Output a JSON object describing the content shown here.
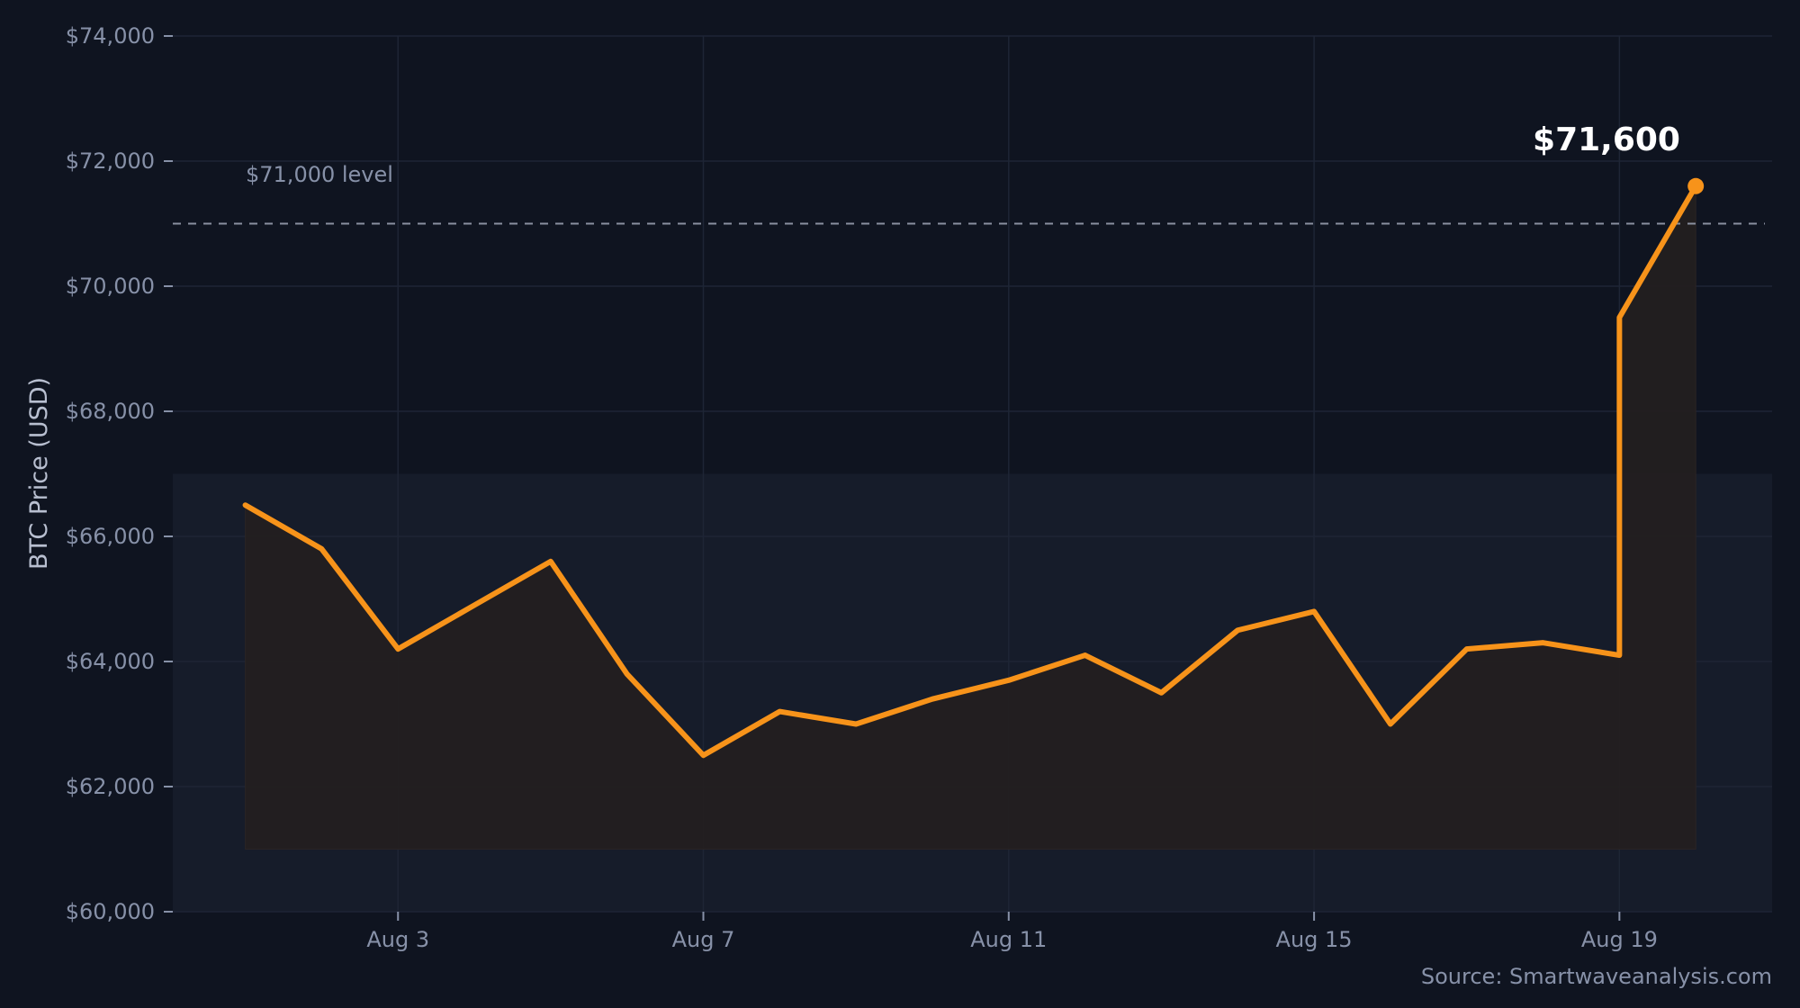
{
  "chart_data": {
    "type": "area",
    "x": [
      "Aug 1",
      "Aug 2",
      "Aug 3",
      "Aug 4",
      "Aug 5",
      "Aug 6",
      "Aug 7",
      "Aug 8",
      "Aug 9",
      "Aug 10",
      "Aug 11",
      "Aug 12",
      "Aug 13",
      "Aug 14",
      "Aug 15",
      "Aug 16",
      "Aug 17",
      "Aug 18",
      "Aug 19",
      "Aug 19",
      "Aug 20"
    ],
    "x_index": [
      1,
      2,
      3,
      4,
      5,
      6,
      7,
      8,
      9,
      10,
      11,
      12,
      13,
      14,
      15,
      16,
      17,
      18,
      19,
      19,
      20
    ],
    "series": [
      {
        "values": [
          66500,
          65800,
          64200,
          64900,
          65600,
          63800,
          62500,
          63200,
          63000,
          63400,
          63700,
          64100,
          63500,
          64500,
          64800,
          63000,
          64200,
          64300,
          64100,
          69500,
          71600
        ]
      }
    ],
    "xticks": [
      "Aug 3",
      "Aug 7",
      "Aug 11",
      "Aug 15",
      "Aug 19"
    ],
    "xtick_index": [
      3,
      7,
      11,
      15,
      19
    ],
    "yticks": [
      "$60,000",
      "$62,000",
      "$64,000",
      "$66,000",
      "$68,000",
      "$70,000",
      "$72,000",
      "$74,000"
    ],
    "ytick_values": [
      60000,
      62000,
      64000,
      66000,
      68000,
      70000,
      72000,
      74000
    ],
    "ylim": [
      60000,
      74000
    ],
    "ylabel": "BTC Price (USD)",
    "xlabel": "",
    "grid": true,
    "reference_line": {
      "value": 71000,
      "label": "$71,000 level"
    },
    "shaded_band": [
      61000,
      67000
    ],
    "end_label": "$71,600",
    "source": "Source: Smartwaveanalysis.com",
    "colors": {
      "background": "#0f1420",
      "line": "#f7931a",
      "grid": "#1e2535",
      "band": "#161c2a",
      "fill": "#241f1f",
      "ref_line": "#8a90a0"
    }
  }
}
